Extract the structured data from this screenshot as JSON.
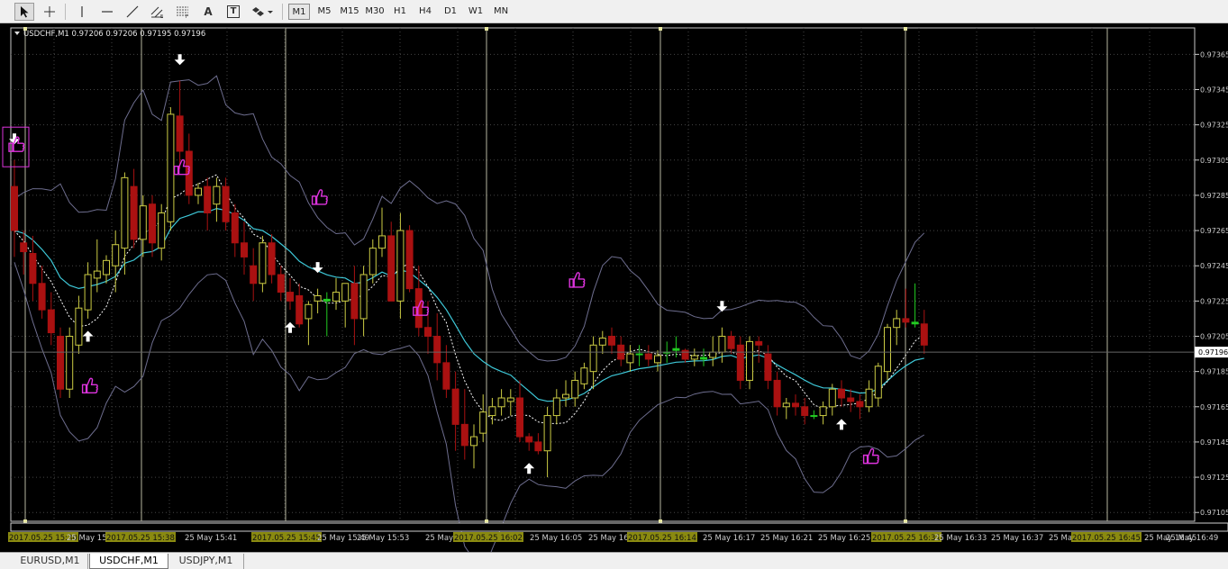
{
  "toolbar": {
    "tools": [
      {
        "name": "cursor-tool",
        "icon": "cursor-arrow-icon"
      },
      {
        "name": "crosshair-tool",
        "icon": "crosshair-icon"
      },
      {
        "name": "vertical-line-tool",
        "icon": "vertical-line-icon"
      },
      {
        "name": "horizontal-line-tool",
        "icon": "horizontal-line-icon"
      },
      {
        "name": "trendline-tool",
        "icon": "trendline-icon"
      },
      {
        "name": "equidistant-channel-tool",
        "icon": "channel-icon"
      },
      {
        "name": "fibonacci-tool",
        "icon": "fibonacci-icon"
      },
      {
        "name": "text-tool",
        "icon": "text-icon",
        "label": "A"
      },
      {
        "name": "text-label-tool",
        "icon": "text-label-icon",
        "label": "T"
      },
      {
        "name": "shapes-menu-tool",
        "icon": "shapes-dropdown-icon"
      }
    ],
    "timeframes": [
      "M1",
      "M5",
      "M15",
      "M30",
      "H1",
      "H4",
      "D1",
      "W1",
      "MN"
    ],
    "active_timeframe": "M1"
  },
  "chart": {
    "header": "USDCHF,M1  0.97206 0.97206 0.97195 0.97196",
    "current_price": "0.97196",
    "colors": {
      "background": "#000000",
      "bull": "#cccc44",
      "bear": "#aa1111",
      "doji": "#22cc22",
      "grid": "#454545",
      "ma_cyan": "#3ec8d8",
      "ma_white": "#ffffff",
      "band": "#6d6d8e",
      "vline": "#b6b6a0",
      "arrow": "#ffffff",
      "thumb": "#dd33dd",
      "axis": "#cccccc",
      "time_highlight": "#8a8a10"
    },
    "icons": {
      "up_arrow": "up-arrow-icon",
      "down_arrow": "down-arrow-icon",
      "thumb": "thumbs-up-icon",
      "menu": "triangle-down-icon"
    }
  },
  "chart_data": {
    "type": "candlestick",
    "title": "USDCHF,M1  0.97206 0.97206 0.97195 0.97196",
    "ylim": [
      0.971,
      0.9738
    ],
    "y_ticks": [
      "0.97365",
      "0.97345",
      "0.97325",
      "0.97305",
      "0.97285",
      "0.97265",
      "0.97245",
      "0.97225",
      "0.97205",
      "0.97185",
      "0.97165",
      "0.97145",
      "0.97125",
      "0.97105"
    ],
    "y_tick_values": [
      0.97365,
      0.97345,
      0.97325,
      0.97305,
      0.97285,
      0.97265,
      0.97245,
      0.97225,
      0.97205,
      0.97185,
      0.97165,
      0.97145,
      0.97125,
      0.97105
    ],
    "x_labels": [
      "2017.05.25 15:30",
      "25 May 15:34",
      "2017.05.25 15:38",
      "25 May 15:41",
      "2017.05.25 15:45",
      "25 May 15:49",
      "25 May 15:53",
      "25 May 15:56",
      "2017.05.25 16:02",
      "25 May 16:05",
      "25 May 16:09",
      "2017.05.25 16:14",
      "25 May 16:17",
      "25 May 16:21",
      "25 May 16:25",
      "2017.05.25 16:31",
      "25 May 16:33",
      "25 May 16:37",
      "25 May 16:41",
      "2017.05.25 16:45",
      "25 May 16:45",
      "25 May 16:49"
    ],
    "ohlc": [
      [
        0.9729,
        0.97305,
        0.9725,
        0.97265
      ],
      [
        0.97258,
        0.97265,
        0.9724,
        0.97253
      ],
      [
        0.97252,
        0.97262,
        0.97225,
        0.97235
      ],
      [
        0.97235,
        0.97245,
        0.97215,
        0.9722
      ],
      [
        0.9722,
        0.9723,
        0.972,
        0.97207
      ],
      [
        0.97205,
        0.9721,
        0.9717,
        0.97175
      ],
      [
        0.97175,
        0.9721,
        0.9717,
        0.97205
      ],
      [
        0.972,
        0.97228,
        0.97195,
        0.97221
      ],
      [
        0.9722,
        0.97247,
        0.97215,
        0.9724
      ],
      [
        0.97238,
        0.9726,
        0.9723,
        0.97242
      ],
      [
        0.9724,
        0.97251,
        0.97235,
        0.97248
      ],
      [
        0.97245,
        0.97265,
        0.9723,
        0.97257
      ],
      [
        0.97255,
        0.97298,
        0.9724,
        0.97295
      ],
      [
        0.9729,
        0.973,
        0.97255,
        0.9726
      ],
      [
        0.9726,
        0.97285,
        0.9725,
        0.97279
      ],
      [
        0.9728,
        0.97285,
        0.9725,
        0.97258
      ],
      [
        0.97255,
        0.9728,
        0.97248,
        0.97275
      ],
      [
        0.9727,
        0.97335,
        0.97265,
        0.97331
      ],
      [
        0.9733,
        0.9735,
        0.973,
        0.9731
      ],
      [
        0.9731,
        0.9732,
        0.9728,
        0.97285
      ],
      [
        0.97285,
        0.97292,
        0.9728,
        0.97289
      ],
      [
        0.9729,
        0.97295,
        0.97265,
        0.97275
      ],
      [
        0.9728,
        0.97295,
        0.9727,
        0.9729
      ],
      [
        0.9729,
        0.97295,
        0.97265,
        0.9727
      ],
      [
        0.97275,
        0.9728,
        0.9725,
        0.97258
      ],
      [
        0.97258,
        0.9727,
        0.9724,
        0.9725
      ],
      [
        0.97245,
        0.97255,
        0.97225,
        0.97235
      ],
      [
        0.97235,
        0.97262,
        0.9723,
        0.97258
      ],
      [
        0.97258,
        0.97263,
        0.97235,
        0.9724
      ],
      [
        0.9724,
        0.97245,
        0.97225,
        0.9723
      ],
      [
        0.9723,
        0.97238,
        0.9722,
        0.97225
      ],
      [
        0.97228,
        0.97235,
        0.9721,
        0.97212
      ],
      [
        0.97215,
        0.97225,
        0.972,
        0.97223
      ],
      [
        0.97225,
        0.97232,
        0.97218,
        0.97228
      ],
      [
        0.97226,
        0.9723,
        0.97205,
        0.97225
      ],
      [
        0.97225,
        0.97238,
        0.9722,
        0.9723
      ],
      [
        0.97225,
        0.97235,
        0.9721,
        0.97235
      ],
      [
        0.97235,
        0.97245,
        0.972,
        0.97215
      ],
      [
        0.97215,
        0.97245,
        0.97205,
        0.9724
      ],
      [
        0.9724,
        0.9726,
        0.97235,
        0.97255
      ],
      [
        0.97255,
        0.97278,
        0.9725,
        0.97262
      ],
      [
        0.97262,
        0.9727,
        0.9723,
        0.97225
      ],
      [
        0.97225,
        0.97275,
        0.97215,
        0.97265
      ],
      [
        0.97265,
        0.97268,
        0.9723,
        0.97232
      ],
      [
        0.97232,
        0.97245,
        0.97205,
        0.9721
      ],
      [
        0.9721,
        0.97225,
        0.97195,
        0.97205
      ],
      [
        0.97205,
        0.97218,
        0.9718,
        0.9719
      ],
      [
        0.9719,
        0.972,
        0.9717,
        0.97175
      ],
      [
        0.97175,
        0.97185,
        0.9714,
        0.97155
      ],
      [
        0.97155,
        0.97175,
        0.97135,
        0.97143
      ],
      [
        0.97143,
        0.97155,
        0.9713,
        0.97148
      ],
      [
        0.9715,
        0.97172,
        0.97145,
        0.97162
      ],
      [
        0.9716,
        0.9717,
        0.97155,
        0.97165
      ],
      [
        0.97165,
        0.97175,
        0.9716,
        0.9717
      ],
      [
        0.97168,
        0.97175,
        0.9716,
        0.9717
      ],
      [
        0.9717,
        0.9718,
        0.97145,
        0.97148
      ],
      [
        0.97148,
        0.9715,
        0.9714,
        0.97145
      ],
      [
        0.97145,
        0.9715,
        0.97138,
        0.9714
      ],
      [
        0.9714,
        0.97165,
        0.97125,
        0.9716
      ],
      [
        0.9716,
        0.97175,
        0.97155,
        0.9717
      ],
      [
        0.9717,
        0.9718,
        0.97165,
        0.97172
      ],
      [
        0.9717,
        0.97185,
        0.97165,
        0.9718
      ],
      [
        0.97178,
        0.9719,
        0.97175,
        0.97187
      ],
      [
        0.97185,
        0.97205,
        0.97175,
        0.972
      ],
      [
        0.972,
        0.97208,
        0.97195,
        0.97204
      ],
      [
        0.97205,
        0.9721,
        0.97195,
        0.972
      ],
      [
        0.972,
        0.97205,
        0.97188,
        0.97192
      ],
      [
        0.9719,
        0.972,
        0.97185,
        0.97195
      ],
      [
        0.97195,
        0.972,
        0.97188,
        0.97195
      ],
      [
        0.97195,
        0.972,
        0.97188,
        0.97192
      ],
      [
        0.9719,
        0.97197,
        0.97185,
        0.97194
      ],
      [
        0.97196,
        0.97202,
        0.9719,
        0.97196
      ],
      [
        0.97198,
        0.97205,
        0.97193,
        0.97197
      ],
      [
        0.97197,
        0.97198,
        0.9719,
        0.97192
      ],
      [
        0.97192,
        0.97198,
        0.97188,
        0.97194
      ],
      [
        0.97193,
        0.97198,
        0.97188,
        0.97192
      ],
      [
        0.97193,
        0.97205,
        0.97188,
        0.97196
      ],
      [
        0.97196,
        0.9721,
        0.9719,
        0.97205
      ],
      [
        0.97205,
        0.97208,
        0.97195,
        0.97198
      ],
      [
        0.972,
        0.97205,
        0.97175,
        0.9718
      ],
      [
        0.9718,
        0.97205,
        0.97175,
        0.97202
      ],
      [
        0.97202,
        0.97205,
        0.9719,
        0.972
      ],
      [
        0.97195,
        0.972,
        0.97175,
        0.9718
      ],
      [
        0.9718,
        0.97185,
        0.9716,
        0.97165
      ],
      [
        0.97165,
        0.9717,
        0.97158,
        0.97167
      ],
      [
        0.97167,
        0.97172,
        0.9716,
        0.97165
      ],
      [
        0.97165,
        0.9717,
        0.97155,
        0.9716
      ],
      [
        0.9716,
        0.97163,
        0.97158,
        0.9716
      ],
      [
        0.9716,
        0.97168,
        0.97155,
        0.97165
      ],
      [
        0.97165,
        0.97178,
        0.9716,
        0.97175
      ],
      [
        0.97175,
        0.9718,
        0.97165,
        0.9717
      ],
      [
        0.9717,
        0.97175,
        0.97162,
        0.97168
      ],
      [
        0.97168,
        0.97172,
        0.97158,
        0.97165
      ],
      [
        0.97165,
        0.9718,
        0.97162,
        0.97175
      ],
      [
        0.9717,
        0.9719,
        0.97165,
        0.97188
      ],
      [
        0.97185,
        0.97212,
        0.9718,
        0.9721
      ],
      [
        0.9721,
        0.9722,
        0.972,
        0.97215
      ],
      [
        0.97215,
        0.97232,
        0.9721,
        0.97213
      ],
      [
        0.97213,
        0.97235,
        0.9721,
        0.97212
      ],
      [
        0.97212,
        0.9722,
        0.97195,
        0.972
      ]
    ],
    "markers": {
      "up_arrows": [
        8,
        30,
        56,
        90
      ],
      "down_arrows": [
        0,
        18,
        33,
        77
      ],
      "thumbs": [
        [
          0,
          0.97315,
          "boxed"
        ],
        [
          8,
          0.97178,
          ""
        ],
        [
          18,
          0.97302,
          ""
        ],
        [
          33,
          0.97285,
          ""
        ],
        [
          44,
          0.97222,
          ""
        ],
        [
          61,
          0.97238,
          ""
        ],
        [
          93,
          0.97138,
          ""
        ]
      ]
    },
    "grid": true
  },
  "tabs": [
    {
      "label": "EURUSD,M1",
      "active": false
    },
    {
      "label": "USDCHF,M1",
      "active": true
    },
    {
      "label": "USDJPY,M1",
      "active": false
    }
  ]
}
